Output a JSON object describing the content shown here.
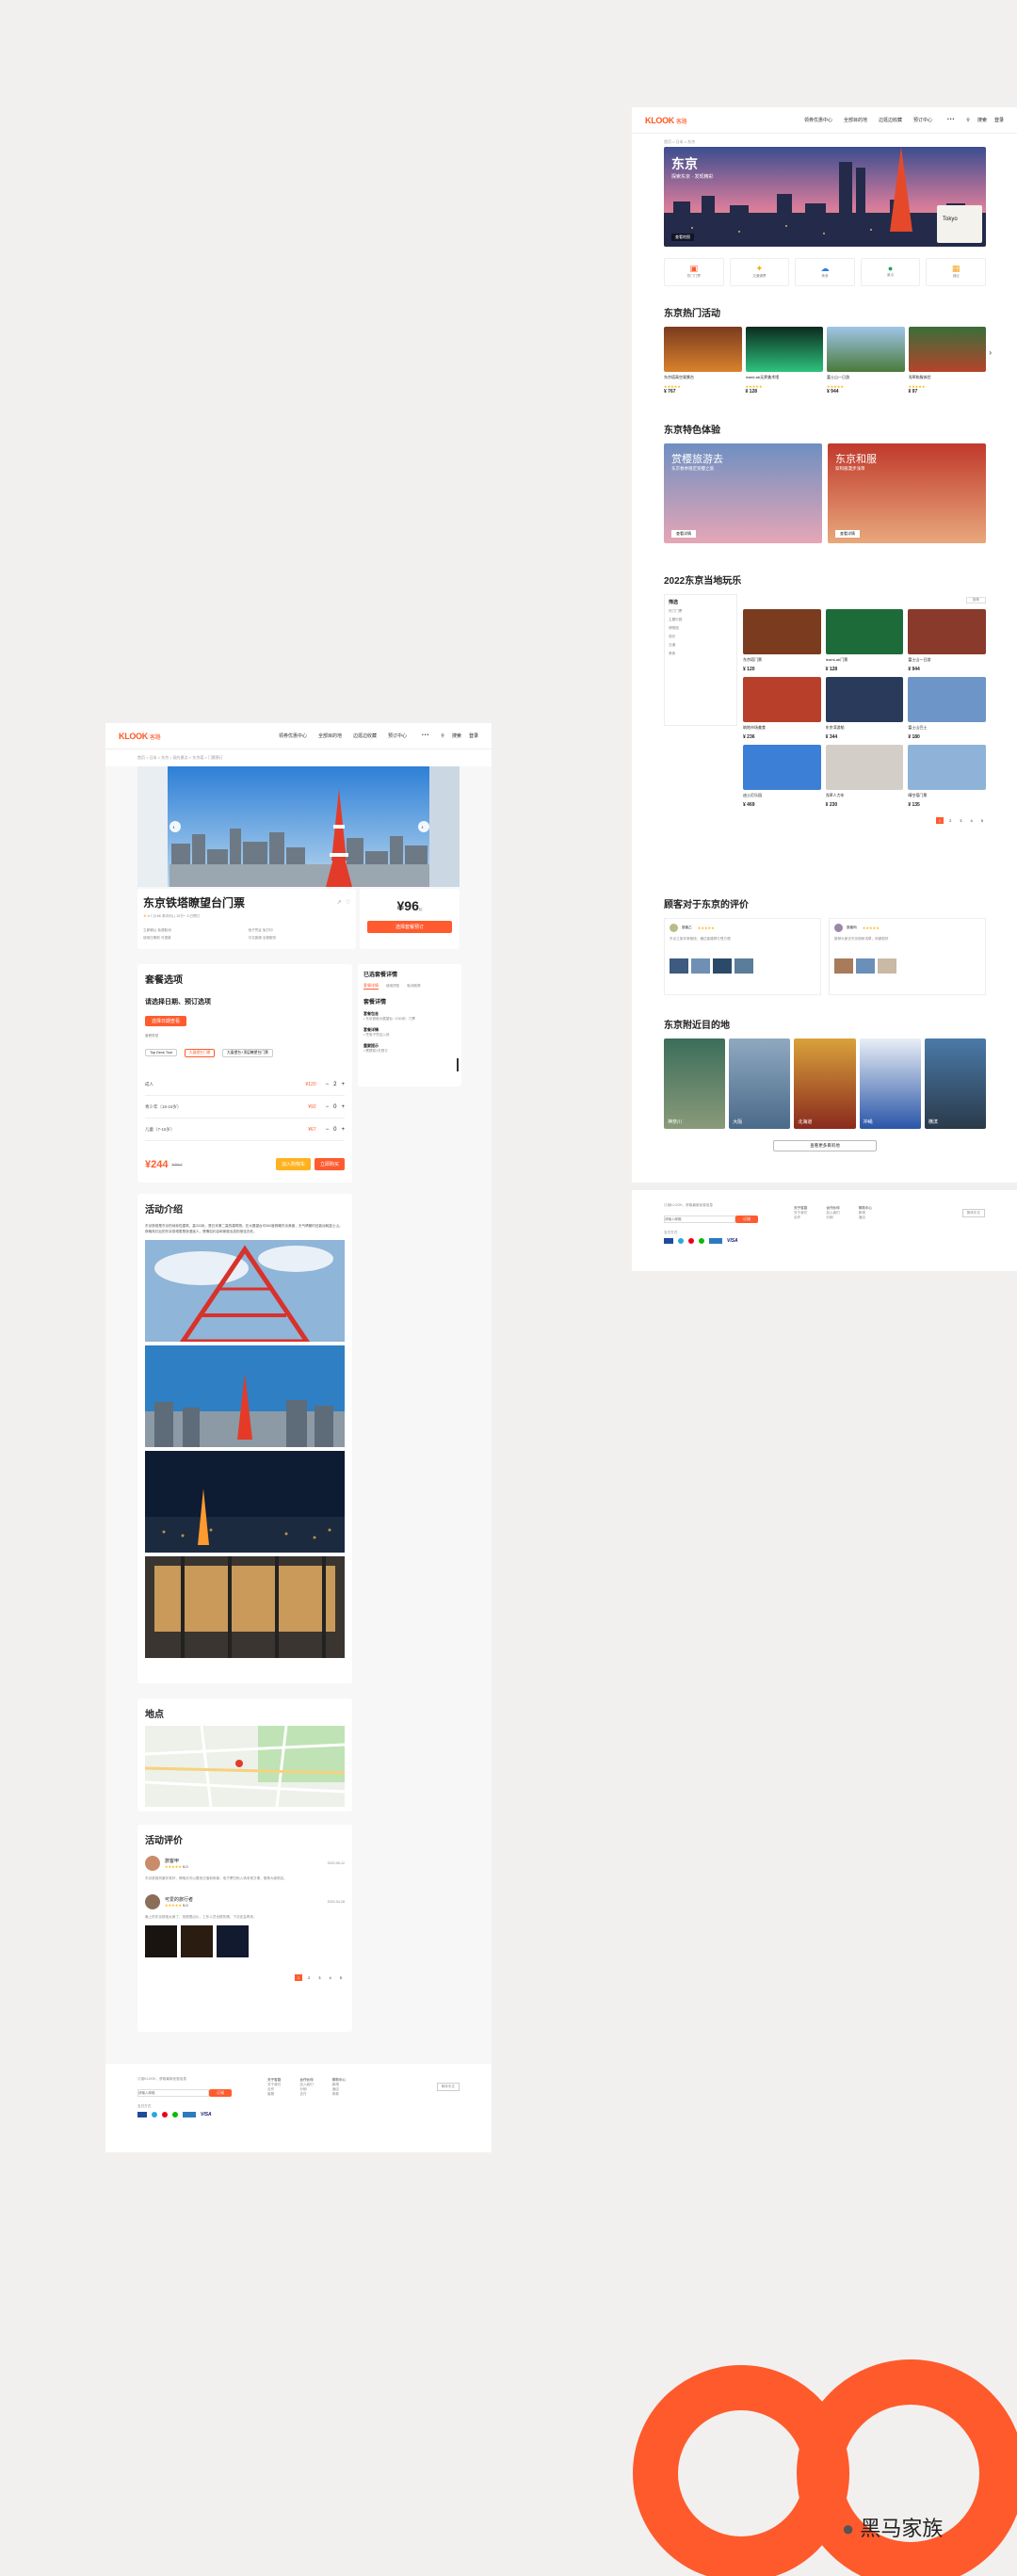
{
  "colors": {
    "accent": "#ff5b2e",
    "bg": "#f2f0ef"
  },
  "brand": {
    "logo": "KLOOK",
    "logo_cn": "客路"
  },
  "nav": {
    "items": [
      "领券优惠中心",
      "全部目的地",
      "边逛边收藏",
      "预订中心"
    ],
    "more": "•••",
    "search": "搜索",
    "login": "注册",
    "signup": "登录"
  },
  "left": {
    "breadcrumb": "首页 > 日本 > 东京 > 观光景点 > 东京塔 > 门票预订",
    "title": "东京铁塔瞭望台门票",
    "rating": "4.7 (3.6K 条评价) | 10万+ 人已预订",
    "price": "¥96",
    "price_suffix": "起",
    "check_btn": "选择套餐预订",
    "features": [
      "立即确认 免费取消",
      "电子凭证 免打印",
      "使用日期前 可退款",
      "中文客服 全程服务"
    ],
    "package": {
      "title": "套餐选项",
      "subtitle": "请选择日期、预订选项",
      "date_btn": "选择日期查看",
      "options_label": "套餐类型",
      "options": [
        "Top Deck Tour",
        "大展望台门票",
        "大展望台+顶层瞭望台门票"
      ],
      "rows": [
        {
          "label": "成人",
          "price": "¥120",
          "qty": "2"
        },
        {
          "label": "青少年（16-18岁）",
          "price": "¥92",
          "qty": "0"
        },
        {
          "label": "儿童（7-15岁）",
          "price": "¥67",
          "qty": "0"
        }
      ],
      "total": "¥244",
      "orig": "¥256.5",
      "cart_btn": "加入购物车",
      "buy_btn": "立即购买"
    },
    "side": {
      "title": "已选套餐详情",
      "tabs": [
        "套餐详情",
        "使用须知",
        "取消政策"
      ],
      "sections": [
        {
          "h": "套餐包含",
          "t": "• 东京铁塔大展望台（150米）门票"
        },
        {
          "h": "套餐详情",
          "t": "• 凭电子凭证入场"
        },
        {
          "h": "重要提示",
          "t": "• 需提前1天预订"
        }
      ]
    },
    "intro": {
      "title": "活动介绍",
      "text": "东京铁塔是东京的地标性建筑，高333米，是日本第二高的建筑物。在大展望台可360度俯瞰东京美景，天气晴朗时还能远眺富士山。夜晚亮灯后的东京铁塔更是浪漫迷人，是情侣约会和家庭出游的绝佳去处。"
    },
    "location": {
      "title": "地点"
    },
    "reviews": {
      "title": "活动评价",
      "items": [
        {
          "name": "旅客甲",
          "score": "5.0",
          "date": "2022-05-12",
          "text": "东京铁塔风景非常好，傍晚去可以看到日落和夜景，电子票扫码入场非常方便，推荐大家购买。"
        },
        {
          "name": "可爱的旅行者",
          "score": "5.0",
          "date": "2022-04-28",
          "text": "晚上的东京铁塔太美了，拍照很出片，工作人员也很热情，下次还会再来。"
        }
      ],
      "pages": [
        "1",
        "2",
        "3",
        "4",
        "5"
      ]
    },
    "footer": {
      "subscribe": "订阅KLOOK，获取最新优惠信息",
      "placeholder": "请输入邮箱",
      "sub_btn": "订阅",
      "cols": [
        "关于客路",
        "合作伙伴",
        "帮助中心"
      ],
      "links": [
        [
          "关于我们",
          "合作",
          "客服"
        ],
        [
          "加入我们",
          "分销",
          "支付"
        ],
        [
          "新闻",
          "酒店",
          "条款"
        ]
      ],
      "pay_label": "支付方式",
      "visa": "VISA",
      "lang": "简体中文"
    }
  },
  "right": {
    "breadcrumb": "首页 > 日本 > 东京",
    "hero": {
      "city": "东京",
      "sub": "探索东京 · 发现精彩",
      "chip": "查看地图",
      "map_label": "Tokyo"
    },
    "cats": [
      "热门门票",
      "交通通票",
      "美食",
      "景点",
      "酒店"
    ],
    "hot": {
      "title": "东京热门活动",
      "items": [
        {
          "t": "东京塔高空观景台",
          "p": "¥ 767"
        },
        {
          "t": "teamLab无界美术馆",
          "p": "¥ 128"
        },
        {
          "t": "富士山一日游",
          "p": "¥ 944"
        },
        {
          "t": "浅草和服体验",
          "p": "¥ 97"
        }
      ]
    },
    "exp": {
      "title": "东京特色体验",
      "items": [
        {
          "t": "赏樱旅游去",
          "sub": "东京春季限定赏樱之旅",
          "b": "查看详情"
        },
        {
          "t": "东京和服",
          "sub": "穿和服漫步浅草",
          "b": "查看详情"
        }
      ]
    },
    "play": {
      "title": "2022东京当地玩乐",
      "filter_title": "筛选",
      "filters": [
        "热门门票",
        "主题乐园",
        "博物馆",
        "观光",
        "交通",
        "美食"
      ],
      "sort": "推荐",
      "items": [
        {
          "t": "东京塔门票",
          "p": "¥ 120"
        },
        {
          "t": "teamLab门票",
          "p": "¥ 128"
        },
        {
          "t": "富士山一日游",
          "p": "¥ 944"
        },
        {
          "t": "筑地市场美食",
          "p": "¥ 236"
        },
        {
          "t": "东京湾游船",
          "p": "¥ 344"
        },
        {
          "t": "富士山巴士",
          "p": "¥ 180"
        },
        {
          "t": "迪士尼乐园",
          "p": "¥ 469"
        },
        {
          "t": "浅草人力车",
          "p": "¥ 230"
        },
        {
          "t": "晴空塔门票",
          "p": "¥ 135"
        }
      ],
      "pages": [
        "1",
        "2",
        "3",
        "4",
        "5"
      ]
    },
    "reviews": {
      "title": "顾客对于东京的评价",
      "items": [
        {
          "name": "旅客乙",
          "text": "东京之旅非常愉快，通过客路预订很方便"
        },
        {
          "name": "旅客丙",
          "text": "推荐大家去东京塔和浅草，风景很好"
        }
      ]
    },
    "near": {
      "title": "东京附近目的地",
      "items": [
        "神奈川",
        "大阪",
        "北海道",
        "冲绳",
        "横滨"
      ],
      "more_btn": "查看更多目的地"
    }
  },
  "watermark": "黑马家族"
}
